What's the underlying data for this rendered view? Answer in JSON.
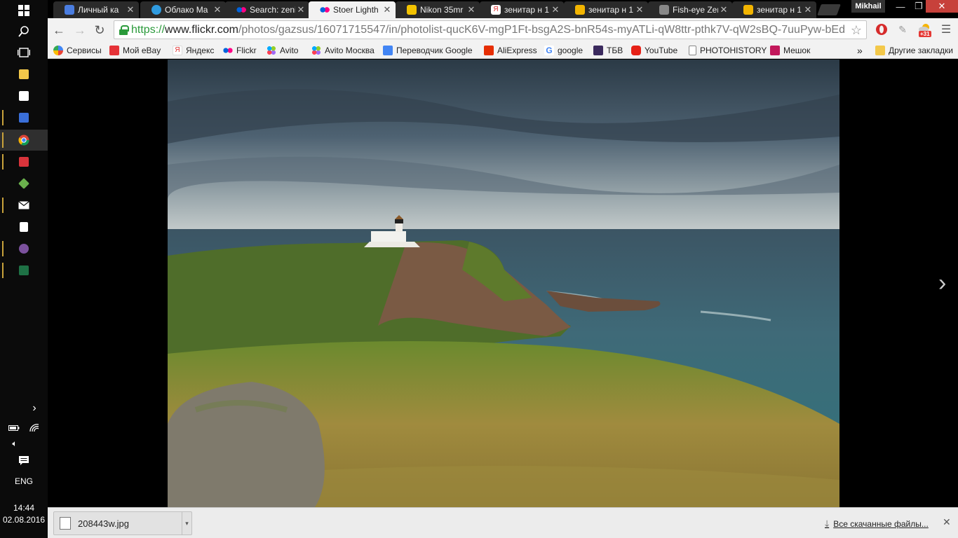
{
  "taskbar": {
    "items": [
      {
        "name": "start-windows-icon",
        "icon": "windows-logo",
        "color": "#ffffff"
      },
      {
        "name": "search-icon",
        "icon": "magnifier",
        "color": "#ffffff"
      },
      {
        "name": "task-view-icon",
        "icon": "task-view",
        "color": "#ffffff"
      },
      {
        "name": "file-explorer-icon",
        "icon": "folder",
        "color": "#f3c84a"
      },
      {
        "name": "store-icon",
        "icon": "shopping-bag",
        "color": "#ffffff"
      },
      {
        "name": "save-app-icon",
        "icon": "floppy-disk",
        "color": "#3a6fd8"
      },
      {
        "name": "chrome-icon",
        "icon": "chrome",
        "color": "#db4437"
      },
      {
        "name": "camera-app-icon",
        "icon": "camera",
        "color": "#d9343b"
      },
      {
        "name": "layers-app-icon",
        "icon": "layers",
        "color": "#6ab04c"
      },
      {
        "name": "mail-icon",
        "icon": "envelope",
        "color": "#ffffff"
      },
      {
        "name": "calculator-icon",
        "icon": "calculator",
        "color": "#ffffff"
      },
      {
        "name": "viber-icon",
        "icon": "viber",
        "color": "#7b519d"
      },
      {
        "name": "excel-icon",
        "icon": "excel",
        "color": "#1e7145"
      }
    ],
    "language": "ENG",
    "time": "14:44",
    "date": "02.08.2016"
  },
  "tabs": [
    {
      "title": "Личный ка",
      "favicon_color": "#4a7de0",
      "active": false
    },
    {
      "title": "Облако Ma",
      "favicon_color": "#2f9be0",
      "active": false
    },
    {
      "title": "Search: zeni",
      "favicon_color": "#ff0084",
      "active": false
    },
    {
      "title": "Stoer Lighth",
      "favicon_color": "#ff0084",
      "active": true
    },
    {
      "title": "Nikon 35mr",
      "favicon_color": "#f2c200",
      "active": false
    },
    {
      "title": "зенитар н 1",
      "favicon_color": "#e03131",
      "active": false
    },
    {
      "title": "зенитар н 1",
      "favicon_color": "#f2b400",
      "active": false
    },
    {
      "title": "Fish-eye Zer",
      "favicon_color": "#888888",
      "active": false
    },
    {
      "title": "зенитар н 1",
      "favicon_color": "#f2b400",
      "active": false
    }
  ],
  "profile_name": "Mikhail",
  "window_controls": {
    "minimize": "—",
    "restore": "❐",
    "close": "✕"
  },
  "toolbar": {
    "back": "←",
    "forward": "→",
    "reload": "↻",
    "url_scheme": "https://",
    "url_host": "www.flickr.com",
    "url_path": "/photos/gazsus/16071715547/in/photolist-qucK6V-mgP1Ft-bsgA2S-bnR54s-myATLi-qW8ttr-pthk7V-qW2sBQ-7uuPyw-bEd",
    "star": "☆",
    "ext_badge": "+31"
  },
  "bookmarks": [
    {
      "label": "Сервисы",
      "favicon_color": "#4a7de0"
    },
    {
      "label": "Мой eBay",
      "favicon_color": "#e53238"
    },
    {
      "label": "Яндекс",
      "favicon_color": "#e03131"
    },
    {
      "label": "Flickr",
      "favicon_color": "#ff0084"
    },
    {
      "label": "Avito",
      "favicon_color": "#00aaff"
    },
    {
      "label": "Avito Москва",
      "favicon_color": "#97cf26"
    },
    {
      "label": "Переводчик Google",
      "favicon_color": "#4285f4"
    },
    {
      "label": "AliExpress",
      "favicon_color": "#e62e04"
    },
    {
      "label": "google",
      "favicon_color": "#4285f4"
    },
    {
      "label": "ТБВ",
      "favicon_color": "#6a3d9a"
    },
    {
      "label": "YouTube",
      "favicon_color": "#e62117"
    },
    {
      "label": "PHOTOHISTORY",
      "favicon_color": "#ffffff"
    },
    {
      "label": "Мешок",
      "favicon_color": "#c2185b"
    }
  ],
  "bookmarks_overflow": "»",
  "other_bookmarks": "Другие закладки",
  "next_arrow": "›",
  "download": {
    "filename": "208443w.jpg",
    "all_downloads": "Все скачанные файлы...",
    "close": "✕"
  }
}
